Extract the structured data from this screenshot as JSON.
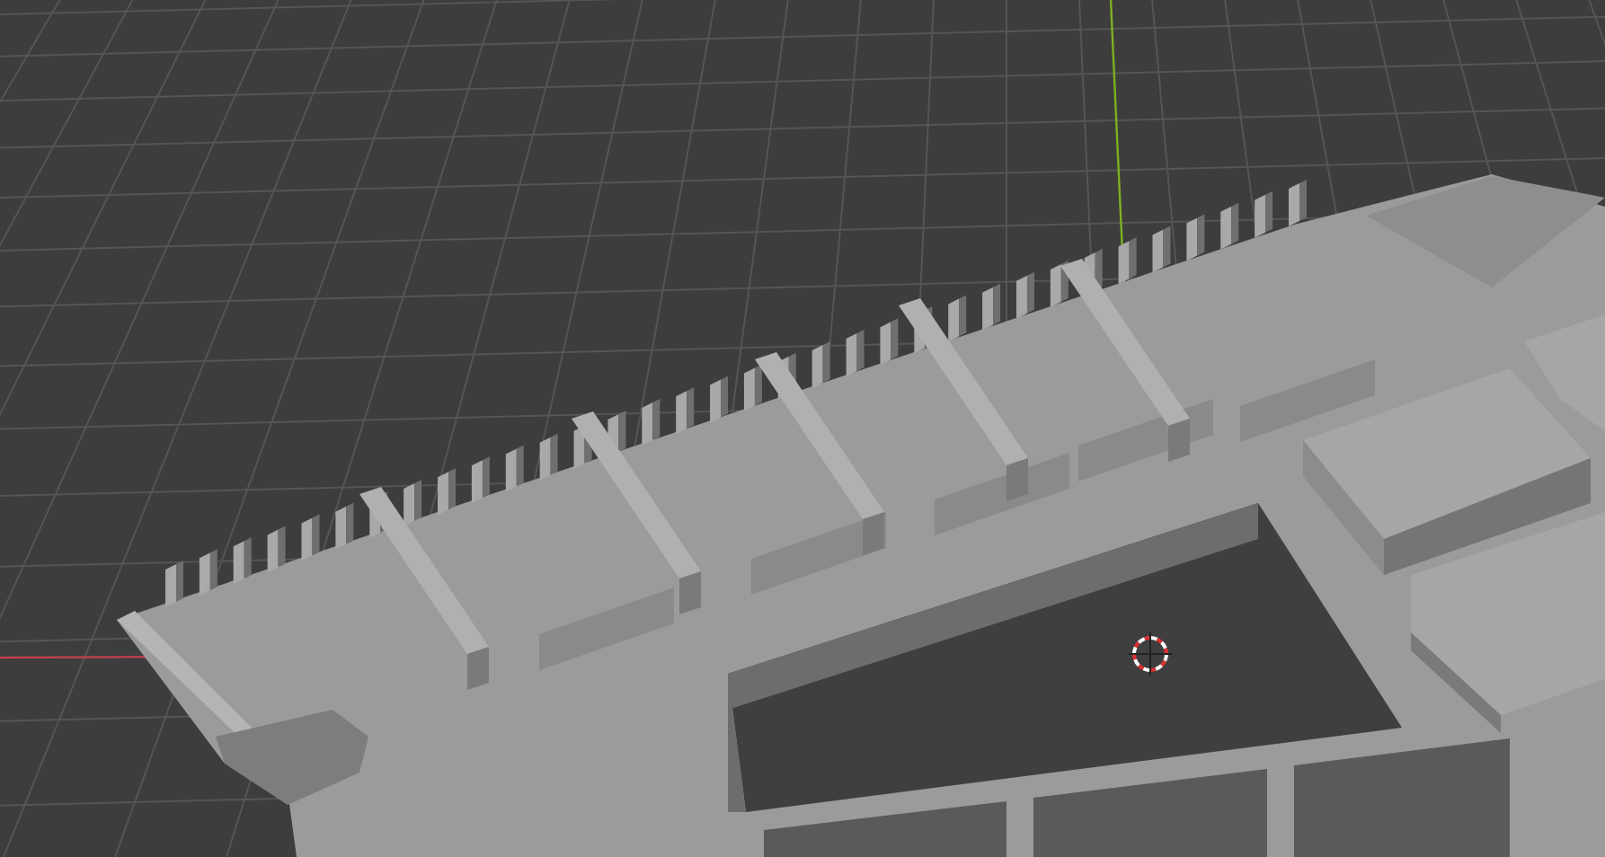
{
  "viewport": {
    "show_grid": true,
    "show_axes": true,
    "show_3d_cursor": true
  }
}
